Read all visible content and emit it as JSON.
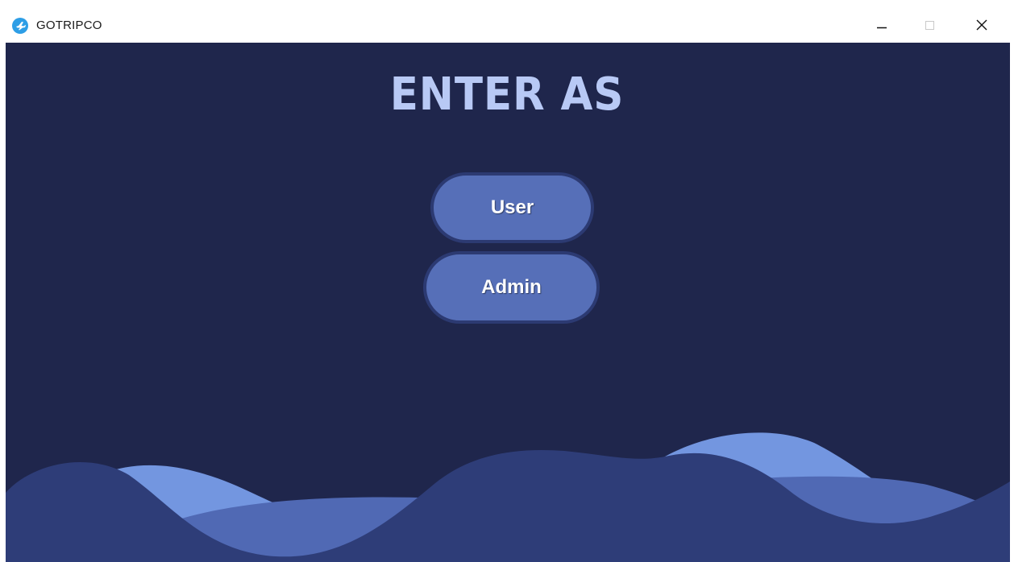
{
  "window": {
    "title": "GOTRIPCO",
    "icon": "airplane-icon",
    "controls": {
      "minimize_icon": "minimize-icon",
      "maximize_icon": "maximize-icon",
      "close_icon": "close-icon"
    }
  },
  "main": {
    "heading": "ENTER AS",
    "buttons": {
      "user_label": "User",
      "admin_label": "Admin"
    }
  },
  "colors": {
    "background": "#1f264c",
    "heading": "#b8c9f5",
    "button_fill": "#566fb8",
    "button_border": "#2c3a72",
    "wave_light": "#7396e0",
    "wave_mid": "#5069b4",
    "wave_dark": "#2e3d78"
  }
}
